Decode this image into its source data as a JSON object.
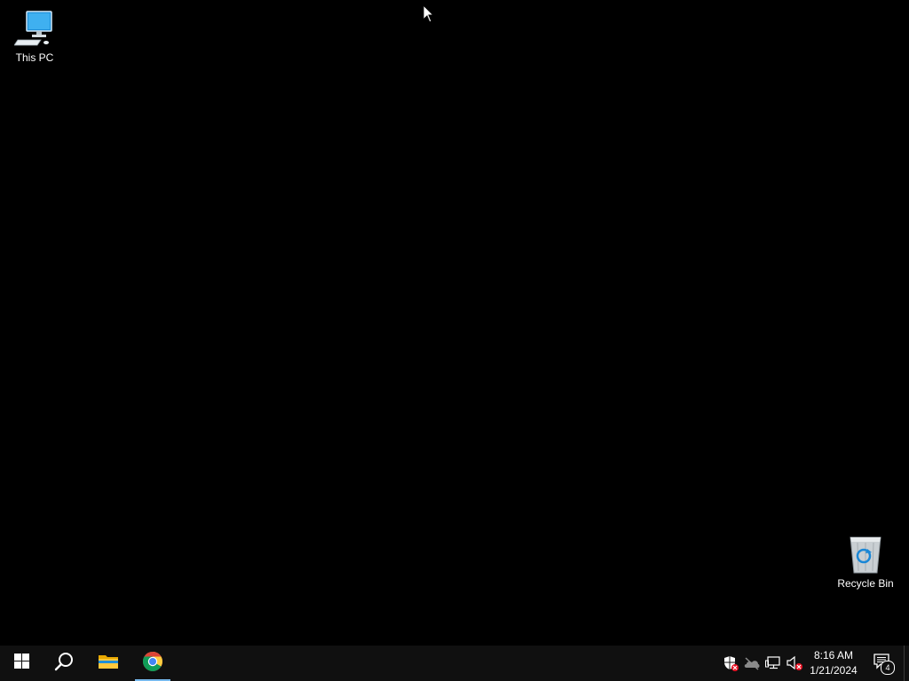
{
  "desktop": {
    "icons": [
      {
        "label": "This PC",
        "icon": "computer-icon"
      },
      {
        "label": "Recycle Bin",
        "icon": "recycle-bin-icon"
      }
    ]
  },
  "taskbar": {
    "start_icon": "windows-logo-icon",
    "search_icon": "search-icon",
    "pinned": [
      {
        "app": "File Explorer",
        "icon": "folder-icon",
        "active": false
      },
      {
        "app": "Google Chrome",
        "icon": "chrome-icon",
        "active": true
      }
    ],
    "tray": {
      "icons": [
        "security-shield-icon",
        "onedrive-icon",
        "network-icon",
        "volume-muted-icon"
      ],
      "time": "8:16 AM",
      "date": "1/21/2024",
      "notification_count": "4"
    }
  },
  "colors": {
    "desktop_bg": "#000000",
    "taskbar_bg": "#101010",
    "accent": "#76b9ed",
    "error_badge": "#e81123"
  }
}
